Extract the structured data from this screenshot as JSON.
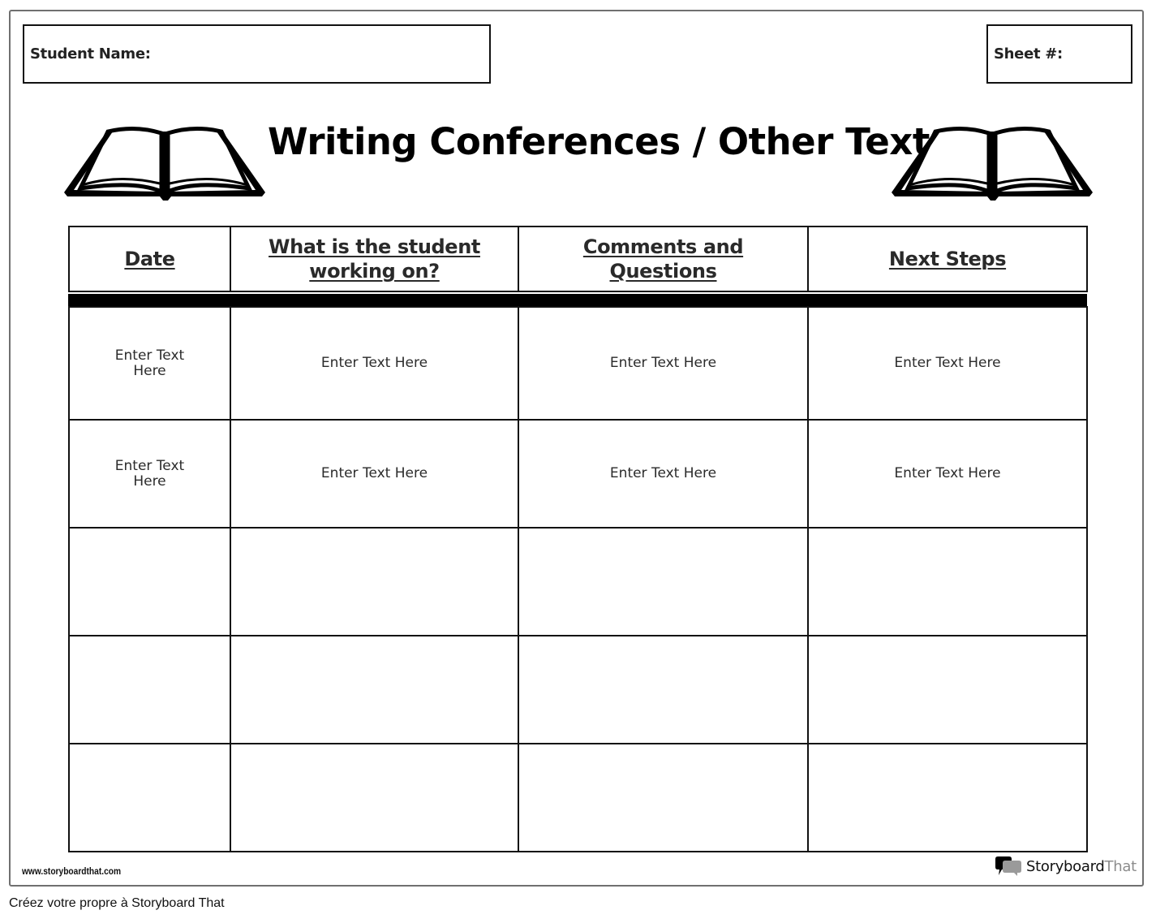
{
  "header": {
    "student_name_label": "Student Name:",
    "sheet_label": "Sheet #:"
  },
  "title": "Writing Conferences / Other Text",
  "icons": {
    "left": "open-book-icon",
    "right": "open-book-icon"
  },
  "table": {
    "columns": [
      "Date",
      "What is the student working on?",
      "Comments and Questions",
      "Next Steps"
    ],
    "rows": [
      [
        "Enter Text Here",
        "Enter Text Here",
        "Enter Text Here",
        "Enter Text Here"
      ],
      [
        "Enter Text Here",
        "Enter Text Here",
        "Enter Text Here",
        "Enter Text Here"
      ],
      [
        "",
        "",
        "",
        ""
      ],
      [
        "",
        "",
        "",
        ""
      ],
      [
        "",
        "",
        "",
        ""
      ]
    ]
  },
  "footer": {
    "website": "www.storyboardthat.com",
    "brand_primary": "Storyboard",
    "brand_accent": "That",
    "caption": "Créez votre propre à Storyboard That"
  },
  "colors": {
    "frame_border": "#707070",
    "ink": "#000000",
    "brand_accent": "#8c8c8c"
  }
}
